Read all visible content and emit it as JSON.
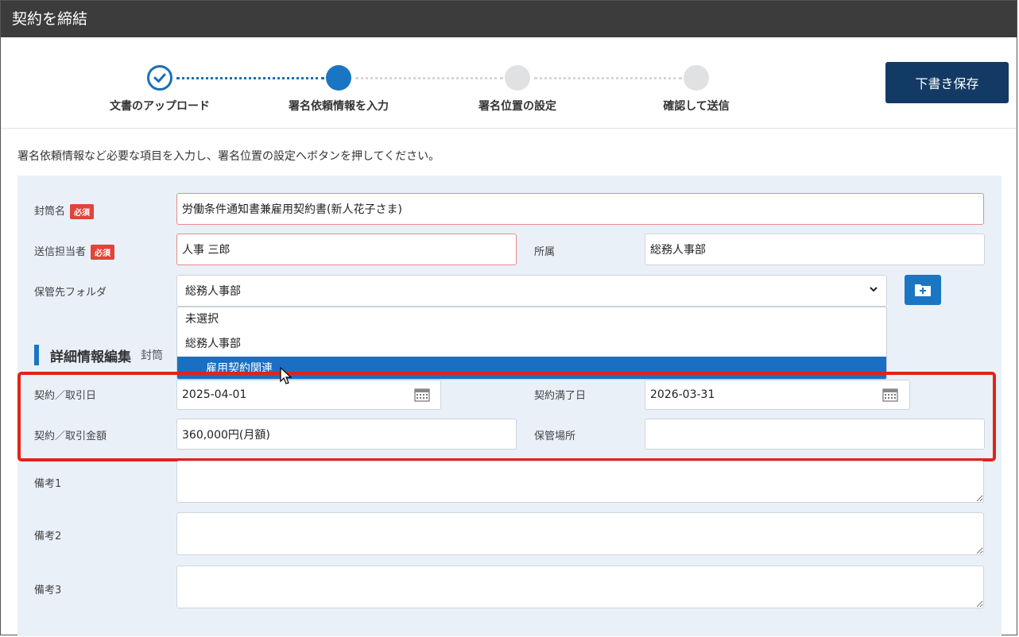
{
  "window": {
    "title": "契約を締結"
  },
  "stepper": {
    "steps": [
      {
        "label": "文書のアップロード",
        "state": "done"
      },
      {
        "label": "署名依頼情報を入力",
        "state": "active"
      },
      {
        "label": "署名位置の設定",
        "state": "todo"
      },
      {
        "label": "確認して送信",
        "state": "todo"
      }
    ]
  },
  "toolbar": {
    "save_draft_label": "下書き保存"
  },
  "instruction": "署名依頼情報など必要な項目を入力し、署名位置の設定へボタンを押してください。",
  "form": {
    "required_badge": "必須",
    "envelope_name": {
      "label": "封筒名",
      "value": "労働条件通知書兼雇用契約書(新人花子さま)"
    },
    "sender": {
      "label": "送信担当者",
      "value": "人事 三郎"
    },
    "department": {
      "label": "所属",
      "value": "総務人事部"
    },
    "folder": {
      "label": "保管先フォルダ",
      "selected": "総務人事部",
      "options": [
        "未選択",
        "総務人事部",
        "雇用契約関連"
      ],
      "highlighted_index": 2
    }
  },
  "details": {
    "title": "詳細情報編集",
    "subtitle": "封筒",
    "contract_date": {
      "label": "契約／取引日",
      "value": "2025-04-01"
    },
    "expiry_date": {
      "label": "契約満了日",
      "value": "2026-03-31"
    },
    "amount": {
      "label": "契約／取引金額",
      "value": "360,000円(月額)"
    },
    "storage_place": {
      "label": "保管場所",
      "value": ""
    },
    "note1": {
      "label": "備考1"
    },
    "note2": {
      "label": "備考2"
    },
    "note3": {
      "label": "備考3"
    }
  },
  "colors": {
    "titlebar": "#3c3c3c",
    "accent": "#1a76c2",
    "save_button": "#123a64",
    "required": "#e0453a",
    "highlight_box": "#e02418",
    "panel": "#e9f0f8"
  }
}
